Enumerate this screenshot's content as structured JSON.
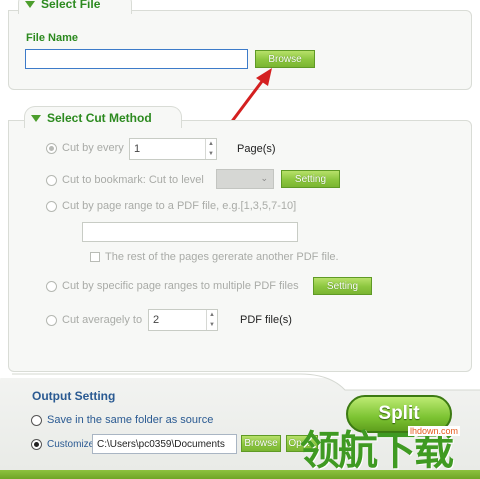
{
  "select_file": {
    "title": "Select File",
    "file_name_label": "File Name",
    "file_name_value": "",
    "browse_label": "Browse"
  },
  "cut_method": {
    "title": "Select Cut Method",
    "every": {
      "label": "Cut by every",
      "value": "1",
      "unit": "Page(s)"
    },
    "bookmark": {
      "label": "Cut to bookmark: Cut to level",
      "level_value": "",
      "setting_label": "Setting"
    },
    "page_range": {
      "label": "Cut by page range to a PDF file, e.g.[1,3,5,7-10]",
      "value": "",
      "rest_label": "The rest of the pages gererate another PDF file."
    },
    "specific": {
      "label": "Cut by specific page ranges to multiple PDF files",
      "setting_label": "Setting"
    },
    "average": {
      "label": "Cut averagely to",
      "value": "2",
      "unit": "PDF file(s)"
    }
  },
  "output": {
    "title": "Output Setting",
    "same_folder_label": "Save in the same folder as source",
    "customize_label": "Customize",
    "path_value": "C:\\Users\\pc0359\\Documents",
    "browse_label": "Browse",
    "open_label": "Ope..."
  },
  "split_label": "Split",
  "watermark": {
    "text": "领航下载",
    "site": "lhdown.com"
  },
  "colors": {
    "accent_green": "#7cc332",
    "label_green": "#2c8a1f",
    "arrow_red": "#d42020"
  },
  "icons": [
    "triangle-down-icon",
    "spinner-arrows-icon",
    "chevron-down-icon",
    "annotation-arrow-icon"
  ]
}
